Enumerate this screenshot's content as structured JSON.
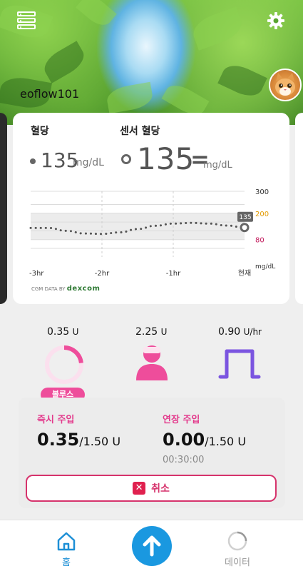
{
  "header": {
    "username": "eoflow101",
    "menu_icon": "menu-list-icon",
    "settings_icon": "gear-icon"
  },
  "glucose_card": {
    "blood_glucose_label": "혈당",
    "blood_glucose_value": "135",
    "blood_glucose_unit": "mg/dL",
    "sensor_glucose_label": "센서 혈당",
    "sensor_glucose_value": "135",
    "sensor_trend": "=",
    "sensor_glucose_unit": "mg/dL",
    "cgm_data_by": "CGM DATA BY",
    "cgm_brand": "dexcom"
  },
  "chart_data": {
    "type": "line",
    "x_tick_labels": [
      "-3hr",
      "-2hr",
      "-1hr",
      "현재"
    ],
    "y_tick_labels": [
      "300",
      "200",
      "80"
    ],
    "y_unit_label": "mg/dL",
    "ylim": [
      40,
      300
    ],
    "target_range": [
      80,
      200
    ],
    "x_hours": [
      -3.0,
      -2.75,
      -2.5,
      -2.25,
      -2.0,
      -1.75,
      -1.5,
      -1.25,
      -1.0,
      -0.75,
      -0.5,
      -0.25,
      0.0
    ],
    "values": [
      133,
      133,
      120,
      108,
      106,
      113,
      128,
      143,
      153,
      156,
      153,
      144,
      135
    ],
    "current_value_label": "135",
    "colors": {
      "line": "#555555",
      "y_200": "#e39b00",
      "y_80": "#c2185b",
      "band": "#ececec"
    }
  },
  "pump_status": {
    "bolus_value": "0.35",
    "bolus_unit": "U",
    "iob_value": "2.25",
    "iob_unit": "U",
    "basal_value": "0.90",
    "basal_unit": "U/hr",
    "bolus_badge": "볼루스",
    "bolus_fraction": 0.233,
    "colors": {
      "pink": "#ee4d9b",
      "purple": "#7b55e0"
    }
  },
  "bolus_card": {
    "immediate_label": "즉시 주입",
    "immediate_value": "0.35",
    "immediate_total": "/1.50 U",
    "extended_label": "연장 주입",
    "extended_value": "0.00",
    "extended_total": "/1.50 U",
    "extended_time": "00:30:00",
    "cancel_label": "취소"
  },
  "bottom_nav": {
    "home_label": "홈",
    "data_label": "데이터",
    "colors": {
      "active": "#1d8fd6",
      "fab": "#1a98e0"
    }
  }
}
